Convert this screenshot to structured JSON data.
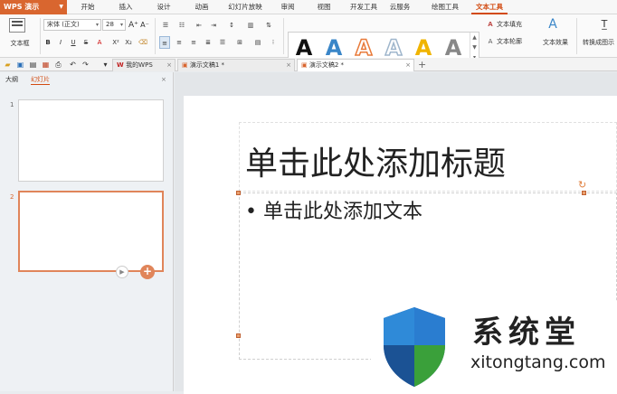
{
  "app": {
    "name": "WPS 演示"
  },
  "menu": {
    "tabs": [
      "开始",
      "插入",
      "设计",
      "动画",
      "幻灯片放映",
      "审阅",
      "视图",
      "开发工具",
      "云服务",
      "绘图工具",
      "文本工具"
    ],
    "active": "文本工具"
  },
  "ribbon": {
    "text_box_label": "文本框",
    "font_name": "宋体 (正文)",
    "font_size": "28",
    "bold": "B",
    "italic": "I",
    "underline": "U",
    "strike": "S",
    "fill_label": "文本填充",
    "outline_label": "文本轮廓",
    "effects_label": "文本效果",
    "convert_label": "转换成图示",
    "gallery": [
      "A",
      "A",
      "A",
      "A",
      "A",
      "A"
    ],
    "gallery_colors": [
      "#111111",
      "#3a86c8",
      "#e87a3a",
      "#9fb6cc",
      "#f0b400",
      "#888888"
    ]
  },
  "doc_tabs": [
    {
      "label": "我的WPS"
    },
    {
      "label": "演示文稿1 *"
    },
    {
      "label": "演示文稿2 *"
    }
  ],
  "sidebar": {
    "tabs": [
      "大纲",
      "幻灯片"
    ],
    "active": "幻灯片",
    "slides": [
      "1",
      "2"
    ]
  },
  "slide": {
    "title": "单击此处添加标题",
    "body": "单击此处添加文本"
  },
  "watermark": {
    "title": "系统堂",
    "url": "xitongtang.com"
  },
  "colors": {
    "accent": "#d9662f",
    "active_tab": "#d24a10",
    "shield_blue": "#1e5fa8",
    "shield_green": "#3aa03a"
  }
}
